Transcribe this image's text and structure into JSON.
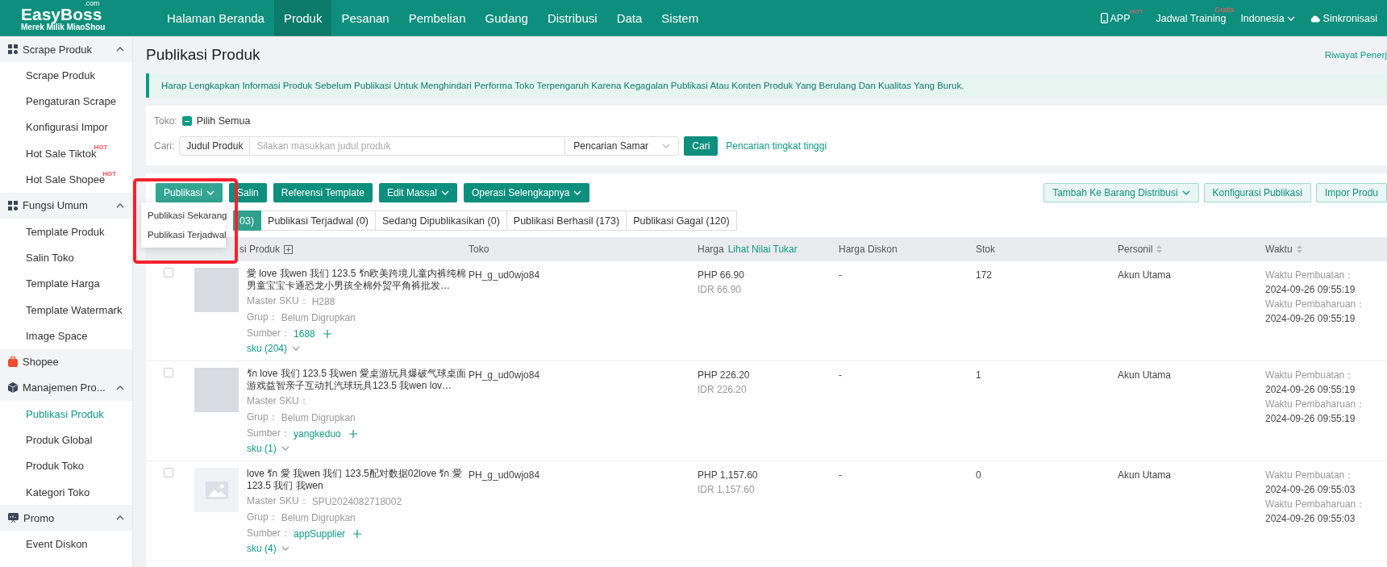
{
  "header": {
    "logo": {
      "name": "EasyBoss",
      "domain": ".com",
      "tagline": "Merek Milik MiaoShou"
    },
    "nav": [
      {
        "label": "Halaman Beranda",
        "selected": false
      },
      {
        "label": "Produk",
        "selected": true
      },
      {
        "label": "Pesanan",
        "selected": false
      },
      {
        "label": "Pembelian",
        "selected": false
      },
      {
        "label": "Gudang",
        "selected": false
      },
      {
        "label": "Distribusi",
        "selected": false
      },
      {
        "label": "Data",
        "selected": false
      },
      {
        "label": "Sistem",
        "selected": false
      }
    ],
    "right": [
      {
        "kind": "app",
        "label": "APP",
        "badge": "HOT"
      },
      {
        "kind": "training",
        "label": "Jadwal Training",
        "badge": "Gratis"
      },
      {
        "kind": "language",
        "label": "Indonesia"
      },
      {
        "kind": "sync",
        "label": "Sinkronisasi"
      }
    ]
  },
  "sidebar": [
    {
      "kind": "grid",
      "label": "Scrape Produk",
      "expanded": true,
      "items": [
        {
          "label": "Scrape Produk",
          "selected": false
        },
        {
          "label": "Pengaturan Scrape",
          "selected": false
        },
        {
          "label": "Konfigurasi Impor",
          "selected": false
        },
        {
          "label": "Hot Sale Tiktok",
          "badge": "HOT",
          "selected": false
        },
        {
          "label": "Hot Sale Shopee",
          "badge": "HOT",
          "selected": false
        }
      ]
    },
    {
      "kind": "grid",
      "label": "Fungsi Umum",
      "expanded": true,
      "items": [
        {
          "label": "Template Produk",
          "selected": false
        },
        {
          "label": "Salin Toko",
          "selected": false
        },
        {
          "label": "Template Harga",
          "selected": false
        },
        {
          "label": "Template Watermark",
          "selected": false
        },
        {
          "label": "Image Space",
          "selected": false
        }
      ]
    },
    {
      "kind": "shop",
      "label": "Shopee"
    },
    {
      "kind": "box",
      "label": "Manajemen Pro...",
      "expanded": true,
      "items": [
        {
          "label": "Publikasi Produk",
          "selected": true
        },
        {
          "label": "Produk Global",
          "selected": false
        },
        {
          "label": "Produk Toko",
          "selected": false
        },
        {
          "label": "Kategori Toko",
          "selected": false
        }
      ]
    },
    {
      "kind": "promo",
      "label": "Promo",
      "expanded": true,
      "items": [
        {
          "label": "Event Diskon",
          "selected": false
        }
      ]
    }
  ],
  "page": {
    "title": "Publikasi Produk",
    "history_link": "Riwayat Penerj",
    "notice": "Harap Lengkapkan Informasi Produk Sebelum Publikasi Untuk Menghindari Performa Toko Terpengaruh Karena Kegagalan Publikasi Atau Konten Produk Yang Berulang Dan Kualitas Yang Buruk."
  },
  "filters": {
    "store_label": "Toko:",
    "select_all": {
      "label": "Pilih Semua",
      "indeterminate": true
    },
    "search_label": "Cari:",
    "search_field": "Judul Produk",
    "search_placeholder": "Silakan masukkan judul produk",
    "search_mode": "Pencarian Samar",
    "search_button": "Cari",
    "advanced_link": "Pencarian tingkat tinggi"
  },
  "toolbar": {
    "left": [
      {
        "label": "Publikasi",
        "dropdown": true
      },
      {
        "label": "Salin",
        "dropdown": false
      },
      {
        "label": "Referensi Template",
        "dropdown": false
      },
      {
        "label": "Edit Massal",
        "dropdown": true
      },
      {
        "label": "Operasi Selengkapnya",
        "dropdown": true
      }
    ],
    "right": [
      {
        "label": "Tambah Ke Barang Distribusi",
        "dropdown": true
      },
      {
        "label": "Konfigurasi Publikasi",
        "dropdown": false
      },
      {
        "label": "Impor Produ",
        "dropdown": false
      }
    ],
    "menu": [
      "Publikasi Sekarang",
      "Publikasi Terjadwal"
    ]
  },
  "tabs": [
    {
      "label": "03)",
      "selected": true
    },
    {
      "label": "Publikasi Terjadwal (0)",
      "selected": false
    },
    {
      "label": "Sedang Dipublikasikan (0)",
      "selected": false
    },
    {
      "label": "Publikasi Berhasil (173)",
      "selected": false
    },
    {
      "label": "Publikasi Gagal (120)",
      "selected": false
    }
  ],
  "table": {
    "columns": [
      {
        "label": "si Produk",
        "kind": "expand"
      },
      {
        "label": "Toko"
      },
      {
        "label": "Harga",
        "link": "Lihat Nilai Tukar"
      },
      {
        "label": "Harga Diskon"
      },
      {
        "label": "Stok"
      },
      {
        "label": "Personil",
        "kind": "sort"
      },
      {
        "label": "Waktu",
        "kind": "sort"
      }
    ],
    "rows": [
      {
        "checked": false,
        "kind": "photo",
        "title": "愛 love 我wen 我们 123.5 รัก欧美跨境儿童内裤纯棉男童宝宝卡通恐龙小男孩全棉外贸平角裤批发…",
        "sku_label": "Master SKU：",
        "sku": "H288",
        "group_label": "Grup：",
        "group": "Belum Digrupkan",
        "source_label": "Sumber：",
        "source": "1688",
        "sku_count": "sku (204)",
        "store": "PH_g_ud0wjo84",
        "price": "PHP 66.90",
        "price_alt": "IDR 66.90",
        "discount": "-",
        "stock": "172",
        "person": "Akun Utama",
        "created_label": "Waktu Pembuatan：",
        "created": "2024-09-26 09:55:19",
        "updated_label": "Waktu Pembaharuan：",
        "updated": "2024-09-26 09:55:19"
      },
      {
        "checked": false,
        "kind": "photo",
        "title": "รัก love 我们 123.5 我wen 愛桌游玩具爆破气球桌面游戏益智亲子互动扎汽球玩具123.5 我wen lov…",
        "sku_label": "Master SKU：",
        "group_label": "Grup：",
        "group": "Belum Digrupkan",
        "source_label": "Sumber：",
        "source": "yangkeduo",
        "sku_count": "sku (1)",
        "store": "PH_g_ud0wjo84",
        "price": "PHP 226.20",
        "price_alt": "IDR 226.20",
        "discount": "-",
        "stock": "1",
        "person": "Akun Utama",
        "created_label": "Waktu Pembuatan：",
        "created": "2024-09-26 09:55:19",
        "updated_label": "Waktu Pembaharuan：",
        "updated": "2024-09-26 09:55:19"
      },
      {
        "checked": false,
        "kind": "empty",
        "title": "love รัก 愛 我wen 我们 123.5配对数据02love รัก 愛 123.5 我们 我wen",
        "sku_label": "Master SKU：",
        "sku": "SPU2024082718002",
        "group_label": "Grup：",
        "group": "Belum Digrupkan",
        "source_label": "Sumber：",
        "source": "appSupplier",
        "sku_count": "sku (4)",
        "store": "PH_g_ud0wjo84",
        "price": "PHP 1,157.60",
        "price_alt": "IDR 1,157.60",
        "discount": "-",
        "stock": "0",
        "person": "Akun Utama",
        "created_label": "Waktu Pembuatan：",
        "created": "2024-09-26 09:55:03",
        "updated_label": "Waktu Pembaharuan：",
        "updated": "2024-09-26 09:55:03"
      }
    ]
  }
}
